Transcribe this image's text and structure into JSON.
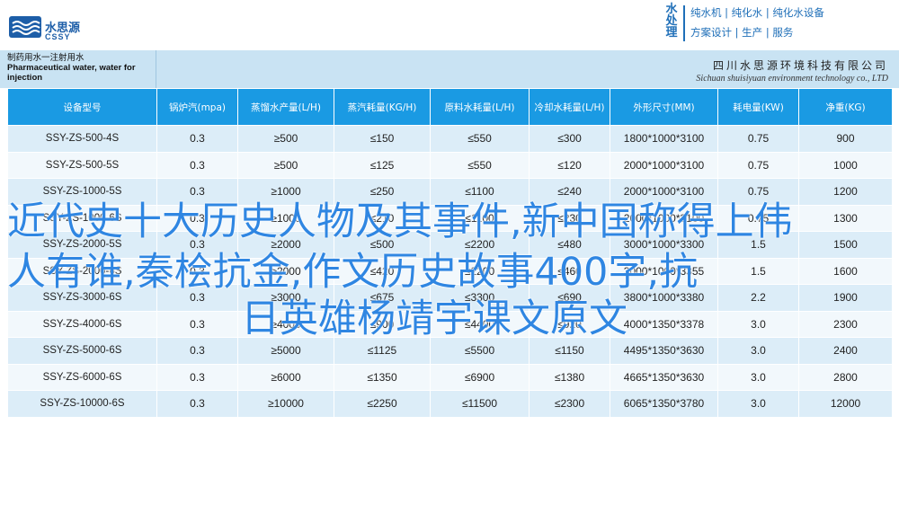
{
  "brand": {
    "name_cn": "水思源",
    "name_en": "CSSY"
  },
  "services": {
    "side_label": "水处理",
    "line1": "纯水机 | 纯化水 | 纯化水设备",
    "line2": "方案设计 | 生产 | 服务"
  },
  "banner": {
    "title_cn": "制药用水一注射用水",
    "title_en": "Pharmaceutical water, water for injection",
    "company_cn": "四川水思源环境科技有限公司",
    "company_en": "Sichuan shuisiyuan environment technology co., LTD"
  },
  "table": {
    "headers": [
      "设备型号",
      "锅炉汽(mpa)",
      "蒸馏水产量(L/H)",
      "蒸汽耗量(KG/H)",
      "原料水耗量(L/H)",
      "冷却水耗量(L/H)",
      "外形尺寸(MM)",
      "耗电量(KW)",
      "净重(KG)"
    ],
    "rows": [
      [
        "SSY-ZS-500-4S",
        "0.3",
        "≥500",
        "≤150",
        "≤550",
        "≤300",
        "1800*1000*3100",
        "0.75",
        "900"
      ],
      [
        "SSY-ZS-500-5S",
        "0.3",
        "≥500",
        "≤125",
        "≤550",
        "≤120",
        "2000*1000*3100",
        "0.75",
        "1000"
      ],
      [
        "SSY-ZS-1000-5S",
        "0.3",
        "≥1000",
        "≤250",
        "≤1100",
        "≤240",
        "2000*1000*3100",
        "0.75",
        "1200"
      ],
      [
        "SSY-ZS-1000-6S",
        "0.3",
        "≥1000",
        "≤210",
        "≤1100",
        "≤230",
        "2000*1000*3100",
        "0.75",
        "1300"
      ],
      [
        "SSY-ZS-2000-5S",
        "0.3",
        "≥2000",
        "≤500",
        "≤2200",
        "≤480",
        "3000*1000*3300",
        "1.5",
        "1500"
      ],
      [
        "SSY-ZS-2000-6S",
        "0.3",
        "≥2000",
        "≤420",
        "≤2200",
        "≤460",
        "3000*1000*3355",
        "1.5",
        "1600"
      ],
      [
        "SSY-ZS-3000-6S",
        "0.3",
        "≥3000",
        "≤675",
        "≤3300",
        "≤690",
        "3800*1000*3380",
        "2.2",
        "1900"
      ],
      [
        "SSY-ZS-4000-6S",
        "0.3",
        "≥4000",
        "≤900",
        "≤4400",
        "≤920",
        "4000*1350*3378",
        "3.0",
        "2300"
      ],
      [
        "SSY-ZS-5000-6S",
        "0.3",
        "≥5000",
        "≤1125",
        "≤5500",
        "≤1150",
        "4495*1350*3630",
        "3.0",
        "2400"
      ],
      [
        "SSY-ZS-6000-6S",
        "0.3",
        "≥6000",
        "≤1350",
        "≤6900",
        "≤1380",
        "4665*1350*3630",
        "3.0",
        "2800"
      ],
      [
        "SSY-ZS-10000-6S",
        "0.3",
        "≥10000",
        "≤2250",
        "≤11500",
        "≤2300",
        "6065*1350*3780",
        "3.0",
        "12000"
      ]
    ]
  },
  "overlay": {
    "line1": "近代史十大历史人物及其事件,新中国称得上伟",
    "line2": "人有谁,秦桧抗金,作文历史故事400字,抗",
    "line3": "日英雄杨靖宇课文原文"
  },
  "colors": {
    "header_blue": "#1a9ae3",
    "banner_blue": "#c9e3f3",
    "overlay_blue": "#2f86e2",
    "row_odd": "#dcedf8",
    "row_even": "#f2f8fc"
  }
}
